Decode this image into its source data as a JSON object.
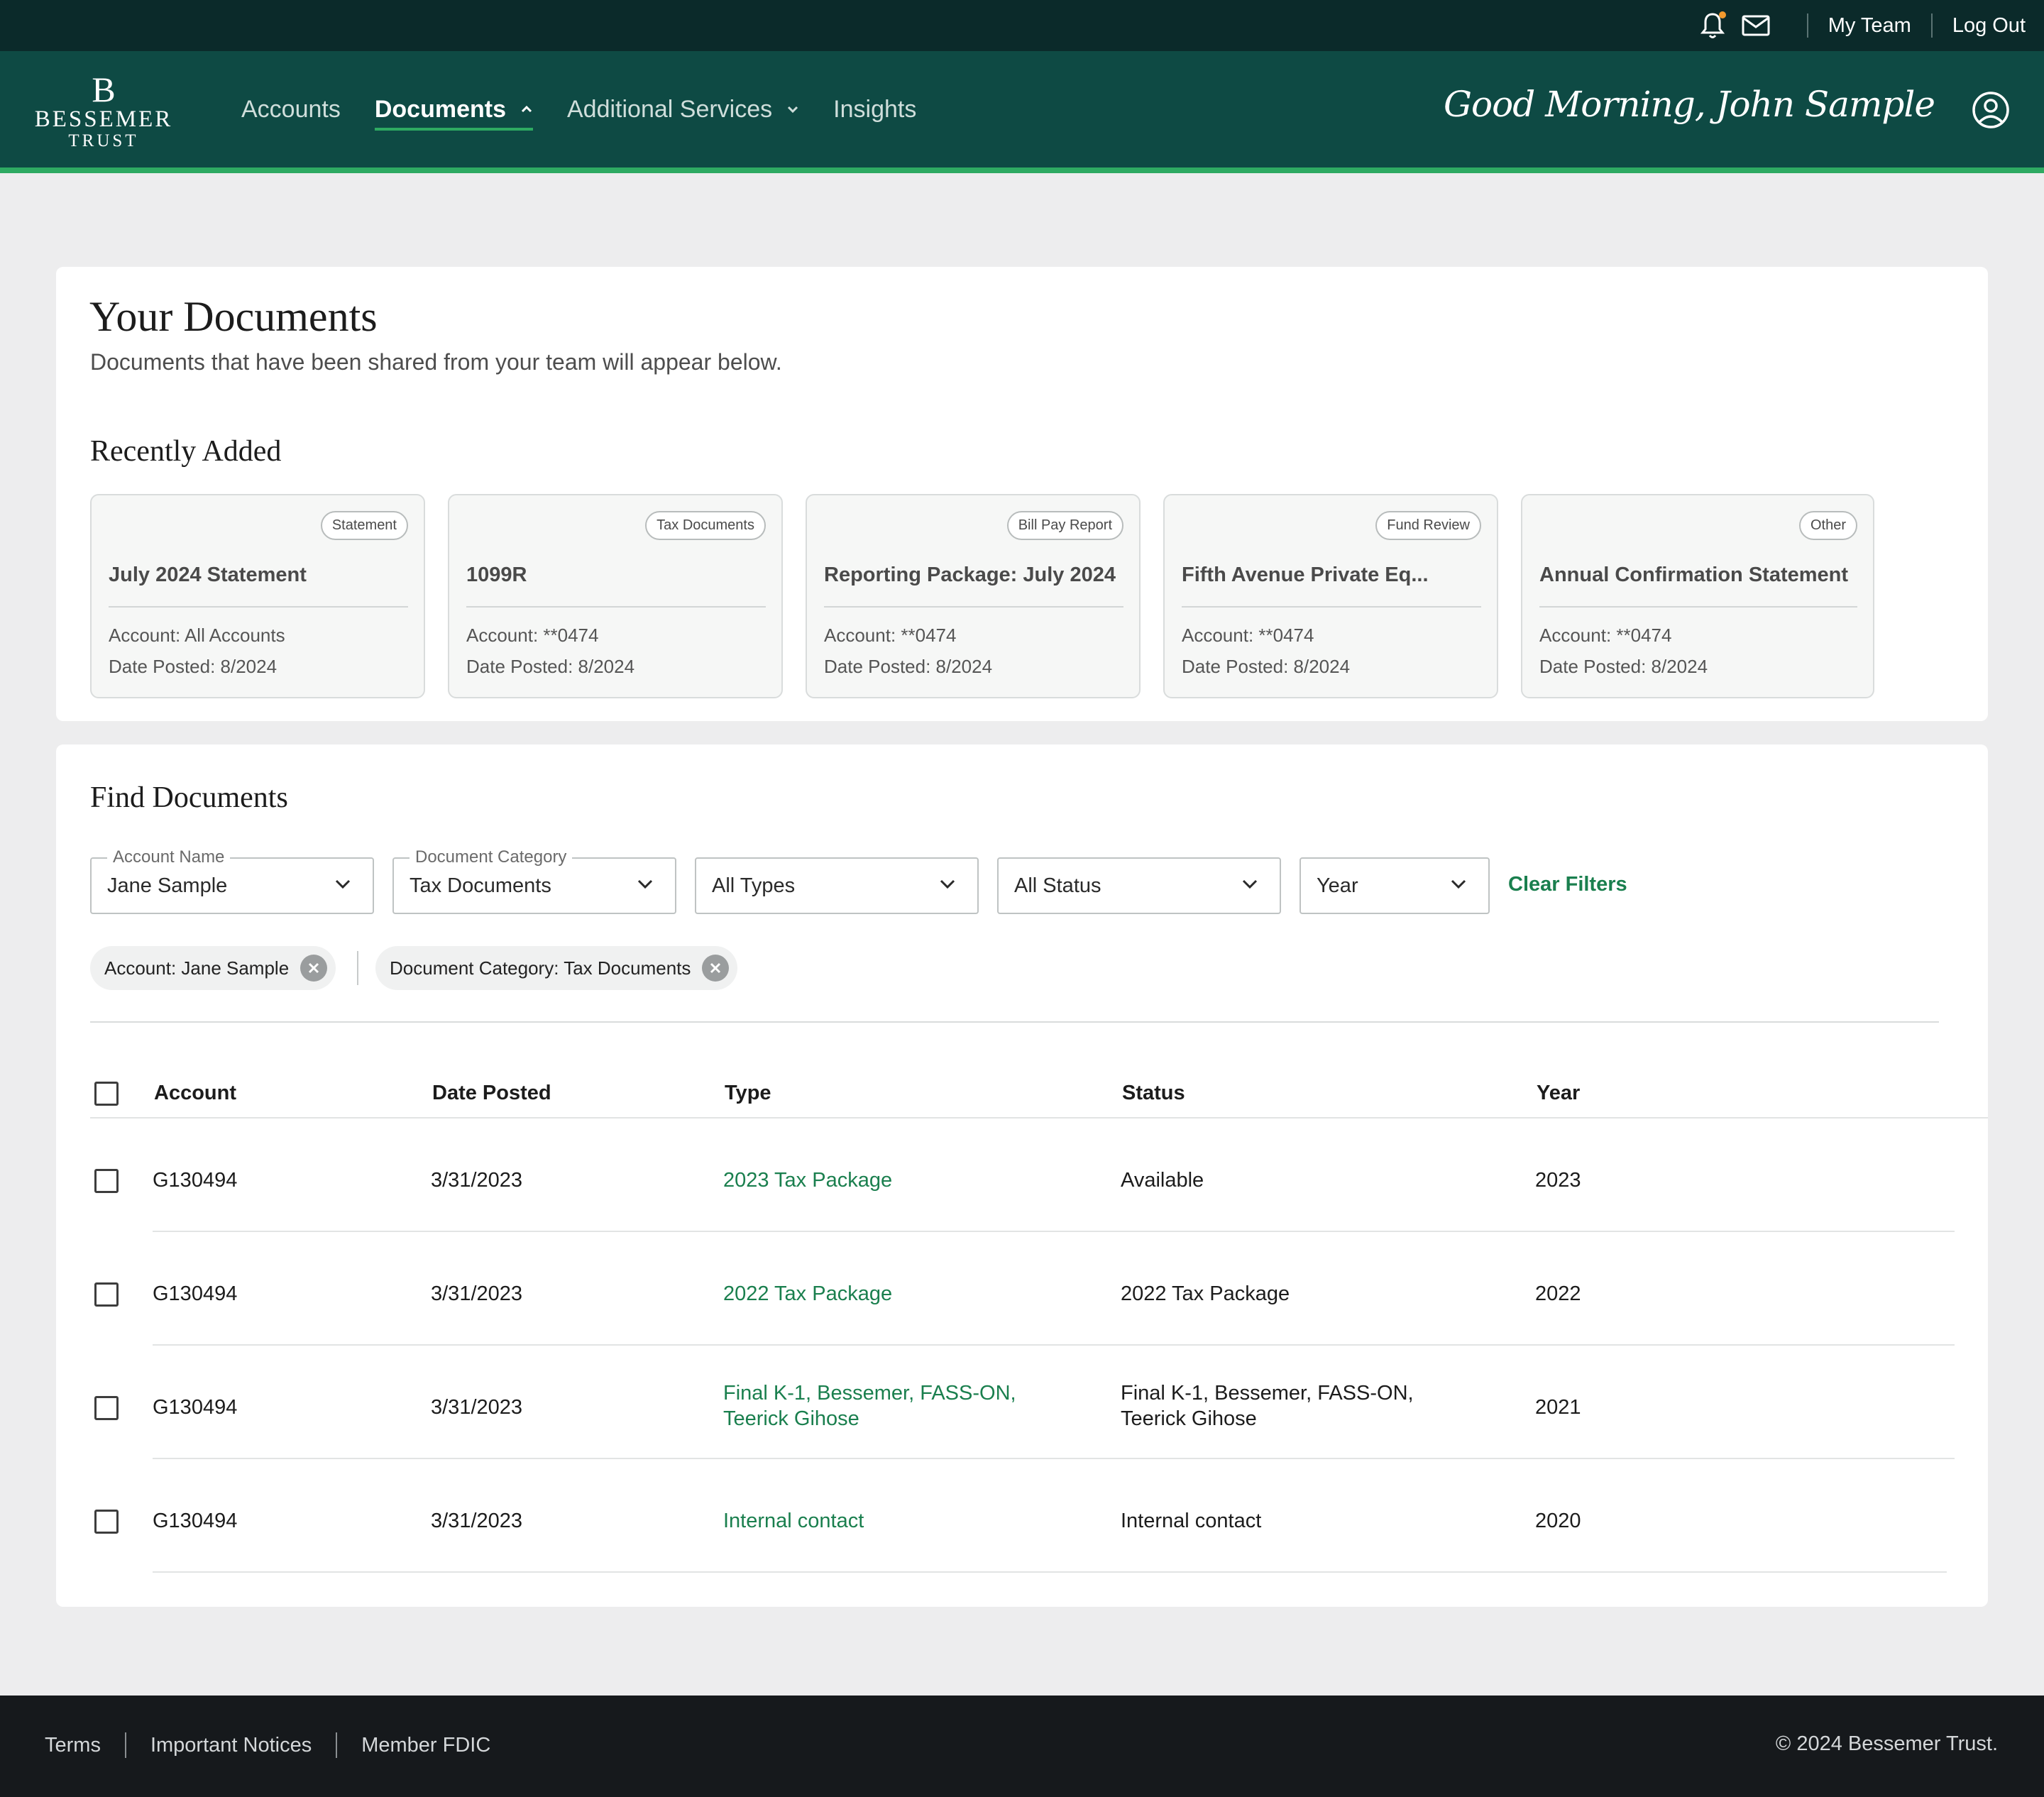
{
  "utility": {
    "my_team": "My Team",
    "log_out": "Log Out"
  },
  "logo": {
    "mark": "B",
    "line1": "BESSEMER",
    "line2": "TRUST"
  },
  "nav": {
    "items": [
      {
        "label": "Accounts",
        "active": false
      },
      {
        "label": "Documents",
        "active": true
      },
      {
        "label": "Additional Services",
        "active": false
      },
      {
        "label": "Insights",
        "active": false
      }
    ],
    "greeting": "Good Morning, John Sample"
  },
  "page": {
    "title": "Your Documents",
    "subtitle": "Documents that have been shared from your team will appear below."
  },
  "recent": {
    "title": "Recently Added",
    "cards": [
      {
        "badge": "Statement",
        "title": "July 2024 Statement",
        "account": "Account: All Accounts",
        "date": "Date Posted: 8/2024"
      },
      {
        "badge": "Tax Documents",
        "title": "1099R",
        "account": "Account: **0474",
        "date": "Date Posted: 8/2024"
      },
      {
        "badge": "Bill Pay Report",
        "title": "Reporting Package: July 2024",
        "account": "Account: **0474",
        "date": "Date Posted: 8/2024"
      },
      {
        "badge": "Fund Review",
        "title": "Fifth Avenue Private Eq...",
        "account": "Account: **0474",
        "date": "Date Posted: 8/2024"
      },
      {
        "badge": "Other",
        "title": "Annual Confirmation Statement",
        "account": "Account: **0474",
        "date": "Date Posted: 8/2024"
      }
    ]
  },
  "find": {
    "title": "Find Documents",
    "filters": {
      "account": {
        "label": "Account Name",
        "value": "Jane Sample"
      },
      "category": {
        "label": "Document Category",
        "value": "Tax Documents"
      },
      "types": {
        "value": "All Types"
      },
      "status": {
        "value": "All Status"
      },
      "year": {
        "value": "Year"
      }
    },
    "clear_filters": "Clear Filters",
    "chips": [
      "Account: Jane Sample",
      "Document Category: Tax Documents"
    ]
  },
  "table": {
    "headers": [
      "Account",
      "Date Posted",
      "Type",
      "Status",
      "Year"
    ],
    "rows": [
      {
        "account": "G130494",
        "date": "3/31/2023",
        "type_l1": "2023 Tax Package",
        "type_l2": "",
        "status_l1": "Available",
        "status_l2": "",
        "year": "2023"
      },
      {
        "account": "G130494",
        "date": "3/31/2023",
        "type_l1": "2022 Tax Package",
        "type_l2": "",
        "status_l1": "2022 Tax Package",
        "status_l2": "",
        "year": "2022"
      },
      {
        "account": "G130494",
        "date": "3/31/2023",
        "type_l1": "Final K-1, Bessemer, FASS-ON,",
        "type_l2": "Teerick Gihose",
        "status_l1": "Final K-1, Bessemer, FASS-ON,",
        "status_l2": "Teerick Gihose",
        "year": "2021"
      },
      {
        "account": "G130494",
        "date": "3/31/2023",
        "type_l1": "Internal contact",
        "type_l2": "",
        "status_l1": "Internal contact",
        "status_l2": "",
        "year": "2020"
      }
    ]
  },
  "footer": {
    "links": [
      "Terms",
      "Important Notices",
      "Member FDIC"
    ],
    "copyright": "© 2024 Bessemer Trust."
  },
  "colors": {
    "utility_bar": "#0b2a2a",
    "nav": "#0e4a44",
    "accent_green": "#2eaa62",
    "link_green": "#1a7f4e",
    "footer": "#16191c"
  },
  "icons": [
    "bell-icon",
    "mail-icon",
    "chevron-up-icon",
    "chevron-down-icon",
    "user-circle-icon",
    "close-icon",
    "checkbox-icon"
  ]
}
